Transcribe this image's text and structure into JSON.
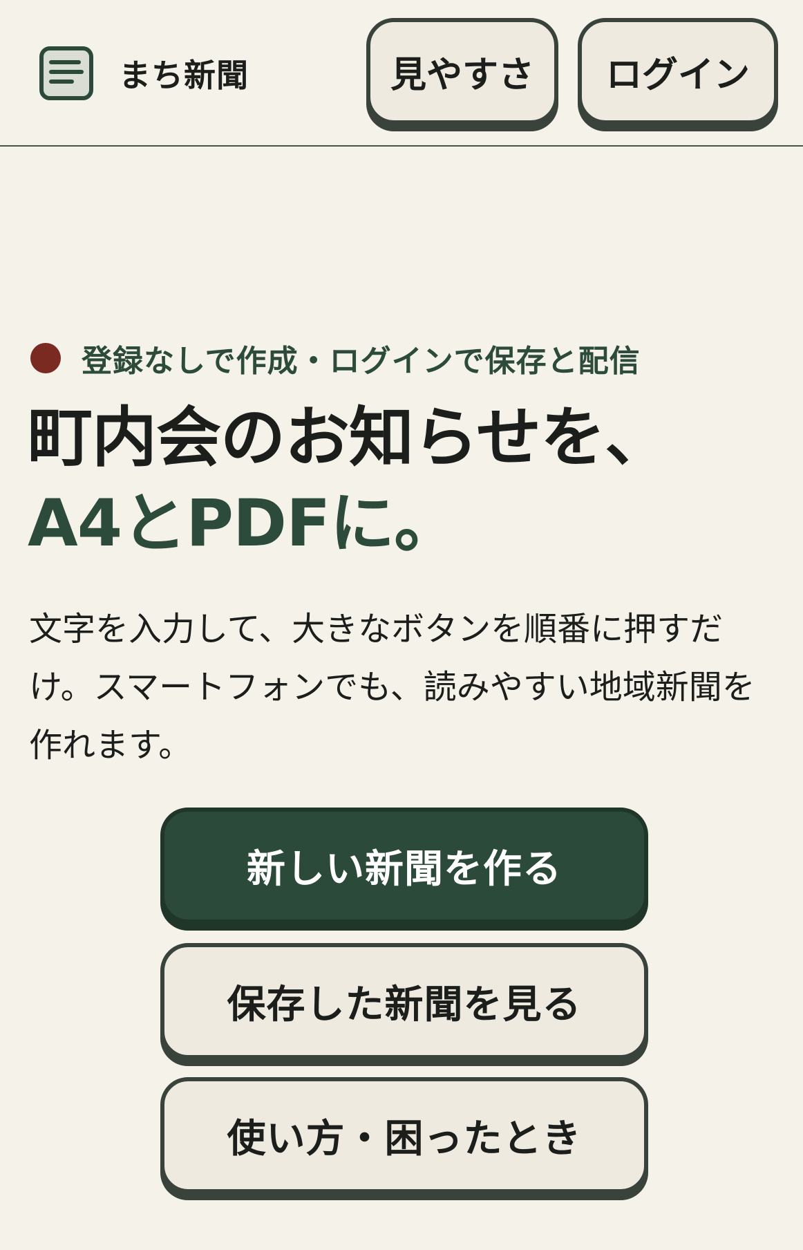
{
  "header": {
    "brand_name": "まち新聞",
    "brand_icon": "newspaper-icon",
    "view_button_label": "見やすさ",
    "login_button_label": "ログイン"
  },
  "hero": {
    "eyebrow": "登録なしで作成・ログインで保存と配信",
    "headline_line1": "町内会のお知らせを、",
    "headline_line2": "A4とPDFに。",
    "lead": "文字を入力して、大きなボタンを順番に押すだけ。スマートフォンでも、読みやすい地域新聞を作れます。"
  },
  "actions": {
    "create_label": "新しい新聞を作る",
    "saved_label": "保存した新聞を見る",
    "help_label": "使い方・困ったとき"
  },
  "colors": {
    "background": "#f5f2ea",
    "primary_green": "#2c4a3a",
    "accent_dot": "#7a2a20",
    "border_dark": "#39433b"
  }
}
